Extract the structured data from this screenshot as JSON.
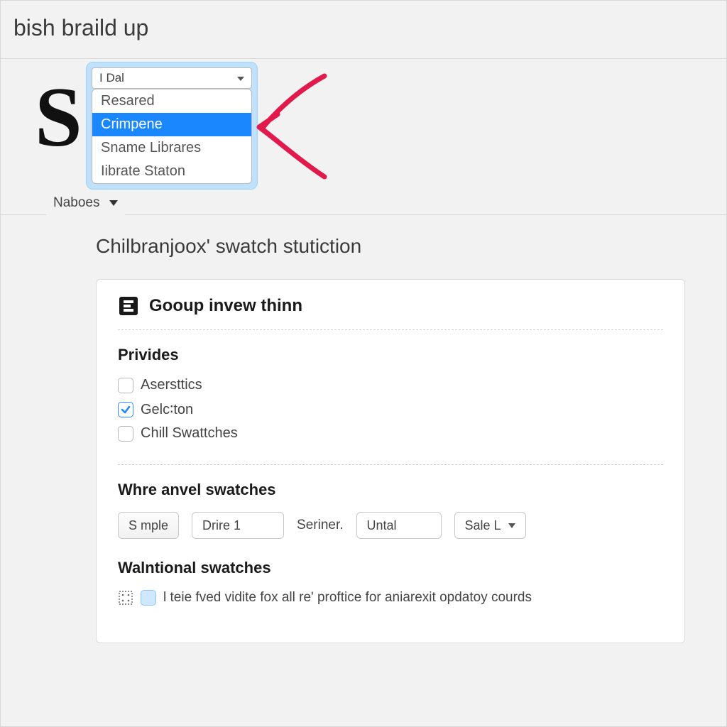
{
  "window": {
    "title": "bish braild up"
  },
  "hero": {
    "glyph": "S",
    "dropdown": {
      "selected": "I  Dal",
      "items": [
        "Resared",
        "Crimpene",
        "Sname Librares",
        "Iibrate Staton"
      ],
      "highlight_index": 1
    },
    "tab": {
      "label": "Naboes"
    }
  },
  "page": {
    "title": "Chilbranjoox' swatch stutiction",
    "panel": {
      "heading": "Gooup invew thinn",
      "sections": {
        "privides": {
          "title": "Privides",
          "items": [
            {
              "label": "Asersttics",
              "checked": false
            },
            {
              "label": "Gelc∶ton",
              "checked": true
            },
            {
              "label": "Chill Swattches",
              "checked": false
            }
          ]
        },
        "swatches": {
          "title": "Whre anvel swatches",
          "button": "S mple",
          "field1": "Drire 1",
          "inline_label": "Seriner.",
          "field2": "Untal",
          "select": "Sale L"
        },
        "opt": {
          "title": "Walntional swatches",
          "checkbox_label": "l teie fved vidite fox all re' proftice for aniarexit opdatoy courds",
          "checkbox_checked": true
        }
      }
    }
  },
  "colors": {
    "highlight": "#1a87ff",
    "focus_ring": "#bfe1fb",
    "annotation": "#e11a4b"
  }
}
